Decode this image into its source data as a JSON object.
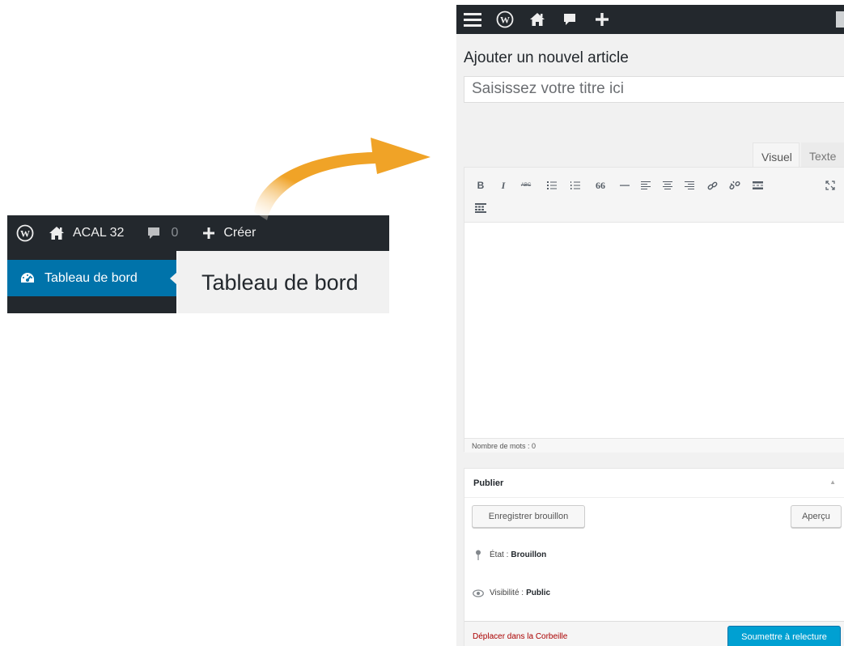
{
  "left_screenshot": {
    "admin_bar": {
      "site_name": "ACAL 32",
      "comments_count": "0",
      "new_label": "Créer"
    },
    "menu": {
      "active_item": "Tableau de bord"
    },
    "content": {
      "heading": "Tableau de bord"
    }
  },
  "right_screenshot": {
    "page_title": "Ajouter un nouvel article",
    "title_input": {
      "placeholder": "Saisissez votre titre ici"
    },
    "editor": {
      "tabs": [
        {
          "label": "Visuel"
        },
        {
          "label": "Texte"
        }
      ],
      "toolbar": {
        "bold": "B",
        "italic": "I",
        "strikethrough": "ABC",
        "blockquote": "66"
      },
      "word_count": "Nombre de mots : 0"
    },
    "publish_box": {
      "heading": "Publier",
      "save_draft": "Enregistrer brouillon",
      "preview": "Aperçu",
      "status_label": "État :",
      "status_value": "Brouillon",
      "visibility_label": "Visibilité :",
      "visibility_value": "Public",
      "trash": "Déplacer dans la Corbeille",
      "submit": "Soumettre à relecture"
    }
  },
  "colors": {
    "admin_bar": "#23282d",
    "menu_active": "#0073aa",
    "content_bg": "#f1f1f1",
    "arrow": "#f0a327",
    "primary_button": "#00a0d2",
    "trash_link": "#aa0000"
  }
}
